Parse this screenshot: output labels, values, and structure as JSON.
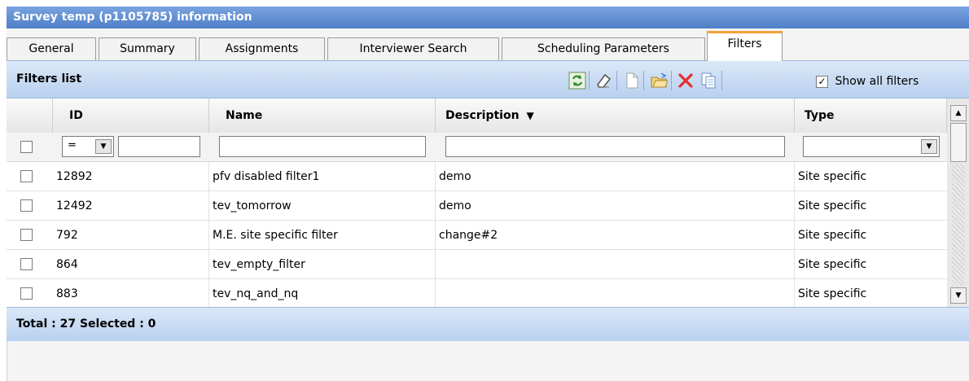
{
  "window": {
    "title": "Survey temp (p1105785) information"
  },
  "tabs": [
    {
      "label": "General"
    },
    {
      "label": "Summary"
    },
    {
      "label": "Assignments"
    },
    {
      "label": "Interviewer Search"
    },
    {
      "label": "Scheduling Parameters"
    },
    {
      "label": "Filters",
      "active": true
    }
  ],
  "toolbar": {
    "title": "Filters list",
    "show_all_label": "Show all filters",
    "show_all_checked": true,
    "icons": [
      "refresh-icon",
      "eraser-icon",
      "new-document-icon",
      "open-folder-icon",
      "delete-icon",
      "copy-icon"
    ]
  },
  "grid": {
    "columns": {
      "id": "ID",
      "name": "Name",
      "description": "Description",
      "type": "Type"
    },
    "sort_indicator": "▼",
    "filter": {
      "id_operator": "=",
      "id_value": "",
      "name_value": "",
      "description_value": "",
      "type_value": ""
    },
    "rows": [
      {
        "id": "12892",
        "name": "pfv disabled filter1",
        "description": "demo",
        "type": "Site specific"
      },
      {
        "id": "12492",
        "name": "tev_tomorrow",
        "description": "demo",
        "type": "Site specific"
      },
      {
        "id": "792",
        "name": "M.E. site specific filter",
        "description": "change#2",
        "type": "Site specific"
      },
      {
        "id": "864",
        "name": "tev_empty_filter",
        "description": "",
        "type": "Site specific"
      },
      {
        "id": "883",
        "name": "tev_nq_and_nq",
        "description": "",
        "type": "Site specific"
      }
    ]
  },
  "footer": {
    "status": "Total : 27 Selected : 0"
  }
}
